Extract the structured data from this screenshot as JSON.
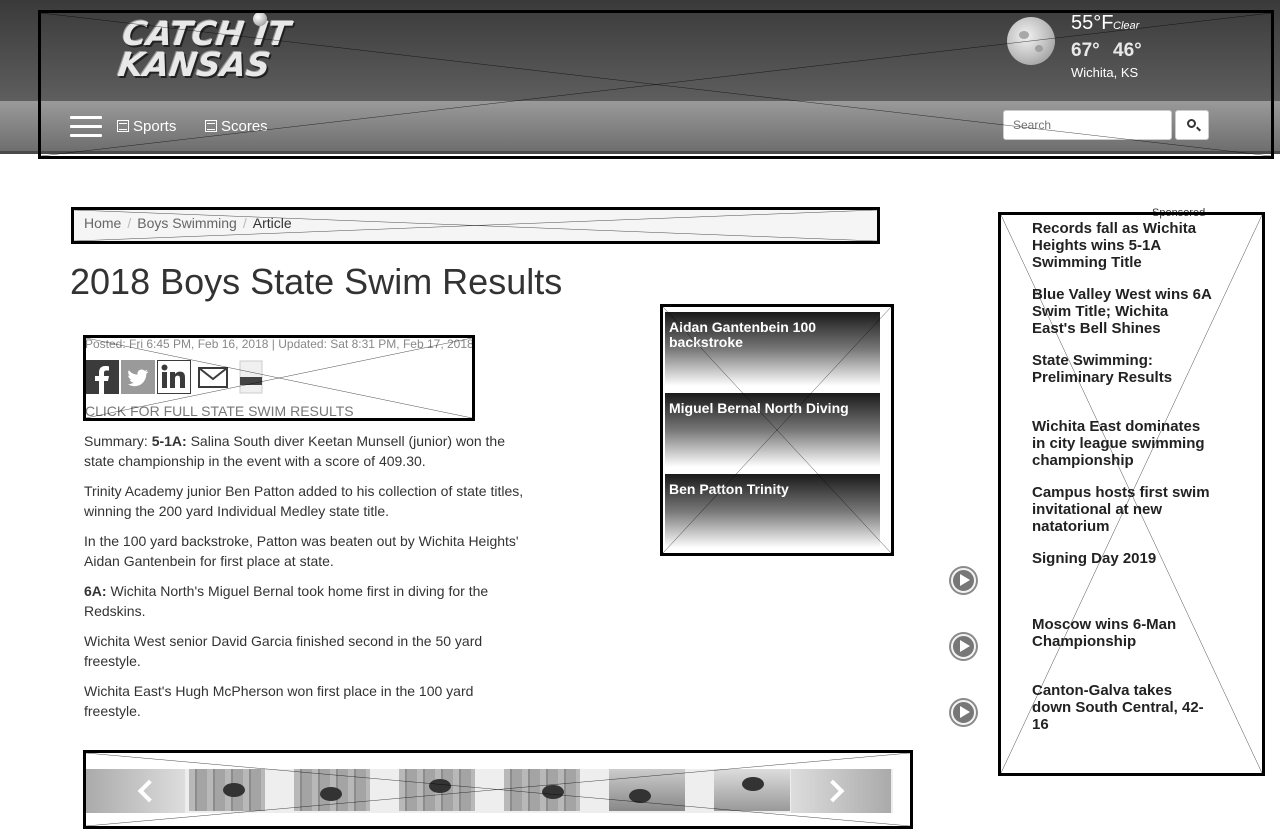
{
  "header": {
    "logo_line1": "CATCH IT",
    "logo_line2": "KANSAS",
    "weather": {
      "temp": "55°F",
      "condition": "Clear",
      "high": "67°",
      "low": "46°",
      "location": "Wichita, KS"
    },
    "nav": {
      "sports": "Sports",
      "scores": "Scores"
    },
    "search": {
      "placeholder": "Search"
    }
  },
  "breadcrumb": {
    "items": [
      "Home",
      "Boys Swimming",
      "Article"
    ],
    "separator": "/"
  },
  "article": {
    "title": "2018 Boys State Swim Results",
    "posted": "Posted: Fri 6:45 PM, Feb 16, 2018",
    "updated": "Updated: Sat 8:31 PM, Feb 17, 2018",
    "full_results_link": "CLICK FOR FULL STATE SWIM RESULTS",
    "paragraphs": [
      {
        "prefix": "Summary: ",
        "bold": "5-1A:",
        "text": " Salina South diver Keetan Munsell (junior) won the state championship in the event with a score of 409.30."
      },
      {
        "prefix": "",
        "bold": "",
        "text": "Trinity Academy junior Ben Patton added to his collection of state titles, winning the 200 yard Individual Medley state title."
      },
      {
        "prefix": "",
        "bold": "",
        "text": "In the 100 yard backstroke, Patton was beaten out by Wichita Heights' Aidan Gantenbein for first place at state."
      },
      {
        "prefix": "",
        "bold": "6A:",
        "text": " Wichita North's Miguel Bernal took home first in diving for the Redskins."
      },
      {
        "prefix": "",
        "bold": "",
        "text": "Wichita West senior David Garcia finished second in the 50 yard freestyle."
      },
      {
        "prefix": "",
        "bold": "",
        "text": "Wichita East's Hugh McPherson won first place in the 100 yard freestyle."
      }
    ]
  },
  "share": {
    "icons": [
      "facebook-icon",
      "twitter-icon",
      "linkedin-icon",
      "email-icon",
      "print-icon"
    ]
  },
  "related": [
    "Aidan Gantenbein 100 backstroke",
    "Miguel Bernal North Diving",
    "Ben Patton Trinity"
  ],
  "sidebar": {
    "sponsored": "Sponsored",
    "stories": [
      "Records fall as Wichita Heights wins 5-1A Swimming Title",
      "Blue Valley West wins 6A Swim Title; Wichita East's Bell Shines",
      "State Swimming: Preliminary Results",
      "Wichita East dominates in city league swimming championship",
      "Campus hosts first swim invitational at new natatorium",
      "Signing Day 2019",
      "Moscow wins 6-Man Championship",
      "Canton-Galva takes down South Central, 42-16"
    ]
  },
  "colors": {
    "header_top": "#4a4a4a",
    "header_nav": "#808080",
    "placeholder_border": "#000000"
  }
}
